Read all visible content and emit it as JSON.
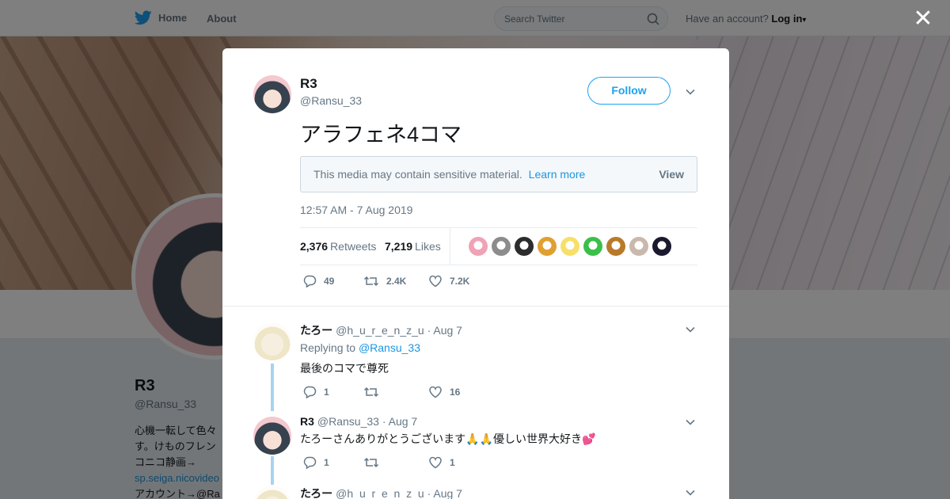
{
  "nav": {
    "home_label": "Home",
    "about_label": "About",
    "search_placeholder": "Search Twitter",
    "have_account": "Have an account?",
    "login_label": "Log in"
  },
  "profile": {
    "name": "R3",
    "handle": "@Ransu_33",
    "bio_lines": [
      "心機一転して色々",
      "す。けものフレン",
      "コニコ静画→",
      "sp.seiga.nicovideo",
      "アカウント→@Ra"
    ]
  },
  "tweet": {
    "author_name": "R3",
    "author_handle": "@Ransu_33",
    "follow_label": "Follow",
    "text": "アラフェネ4コマ",
    "sensitive_notice": "This media may contain sensitive material.",
    "learn_more": "Learn more",
    "view_label": "View",
    "timestamp": "12:57 AM - 7 Aug 2019",
    "retweets_count": "2,376",
    "retweets_label": "Retweets",
    "likes_count": "7,219",
    "likes_label": "Likes",
    "likers": [
      "#f0a3b6",
      "#8c8c8c",
      "#2c2c2c",
      "#e0a030",
      "#f6e06a",
      "#3cbf4a",
      "#b87a2a",
      "#c9b8ad",
      "#1a1a2e"
    ],
    "replies": "49",
    "retweets_short": "2.4K",
    "likes_short": "7.2K"
  },
  "replies": [
    {
      "name": "たろー",
      "handle": "@h_u_r_e_n_z_u",
      "date": "· Aug 7",
      "replying_prefix": "Replying to",
      "replying_to": "@Ransu_33",
      "text": "最後のコマで尊死",
      "reply_count": "1",
      "retweet_count": "",
      "like_count": "16"
    },
    {
      "name": "R3",
      "handle": "@Ransu_33",
      "date": "· Aug 7",
      "text": "たろーさんありがとうございます🙏🙏優しい世界大好き💕",
      "reply_count": "1",
      "retweet_count": "",
      "like_count": "1"
    },
    {
      "name": "たろー",
      "handle": "@h_u_r_e_n_z_u",
      "date": "· Aug 7"
    }
  ],
  "colors": {
    "twitter_blue": "#1da1f2",
    "link_blue": "#1b95e0",
    "thread_line": "#a6d3f1"
  }
}
